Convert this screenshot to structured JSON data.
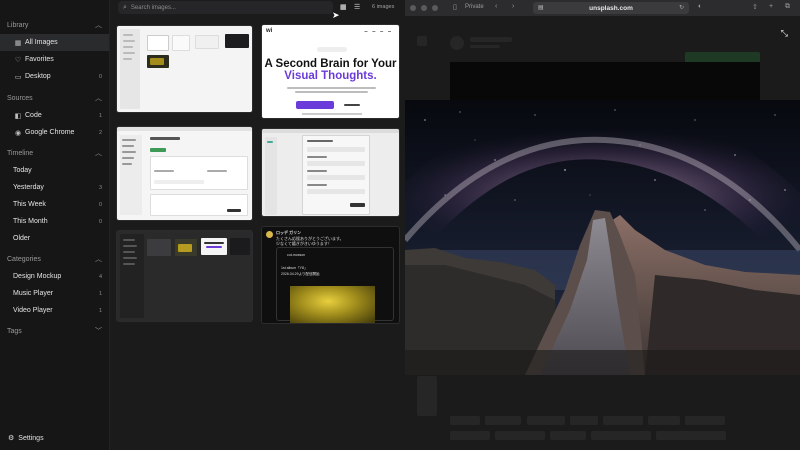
{
  "sidebar": {
    "library": {
      "title": "Library",
      "items": [
        {
          "label": "All Images",
          "count": "",
          "icon": "images-icon",
          "glyph": "▦",
          "active": true
        },
        {
          "label": "Favorites",
          "count": "",
          "icon": "heart-icon",
          "glyph": "♡"
        },
        {
          "label": "Desktop",
          "count": "0",
          "icon": "monitor-icon",
          "glyph": "▭"
        }
      ]
    },
    "sources": {
      "title": "Sources",
      "items": [
        {
          "label": "Code",
          "count": "1",
          "icon": "code-app-icon",
          "glyph": "◧"
        },
        {
          "label": "Google Chrome",
          "count": "2",
          "icon": "chrome-icon",
          "glyph": "◉"
        }
      ]
    },
    "timeline": {
      "title": "Timeline",
      "items": [
        {
          "label": "Today",
          "count": ""
        },
        {
          "label": "Yesterday",
          "count": "3"
        },
        {
          "label": "This Week",
          "count": "0"
        },
        {
          "label": "This Month",
          "count": "0"
        },
        {
          "label": "Older",
          "count": ""
        }
      ]
    },
    "categories": {
      "title": "Categories",
      "items": [
        {
          "label": "Design Mockup",
          "count": "4"
        },
        {
          "label": "Music Player",
          "count": "1"
        },
        {
          "label": "Video Player",
          "count": "1"
        }
      ]
    },
    "tags": {
      "title": "Tags"
    },
    "settings_label": "Settings"
  },
  "grid": {
    "search_placeholder": "Search images...",
    "count_label": "6 images",
    "tile2": {
      "logo": "wi",
      "headline1": "A Second Brain for Your",
      "headline2": "Visual Thoughts."
    },
    "tile6": {
      "user": "ロッデ ガリン",
      "line1": "たくさん応援ありがとうございます。",
      "line2": "少なくて嬉ぎがきいゆうます！",
      "quote_user": "cut-mosson",
      "quote_line1": "1st album「Y8」",
      "quote_line2": "2026.04.29より配信開始"
    }
  },
  "browser": {
    "private_label": "Private",
    "url": "unsplash.com",
    "accent": "#6a3bd8"
  }
}
